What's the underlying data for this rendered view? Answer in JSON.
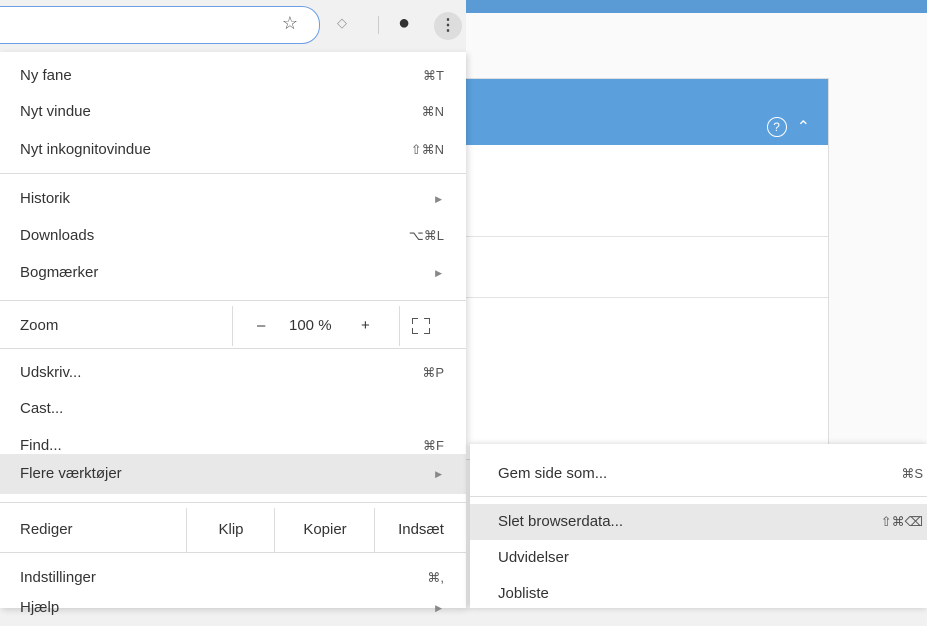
{
  "toolbar": {
    "star_icon": "☆",
    "extension_icon": "◇",
    "profile_icon": "●",
    "kebab_icon": "⋮"
  },
  "menu": {
    "new_tab": {
      "label": "Ny fane",
      "shortcut": "⌘T"
    },
    "new_window": {
      "label": "Nyt vindue",
      "shortcut": "⌘N"
    },
    "new_incognito": {
      "label": "Nyt inkognitovindue",
      "shortcut": "⇧⌘N"
    },
    "history": {
      "label": "Historik"
    },
    "downloads": {
      "label": "Downloads",
      "shortcut": "⌥⌘L"
    },
    "bookmarks": {
      "label": "Bogmærker"
    },
    "zoom": {
      "label": "Zoom",
      "minus": "–",
      "value": "100 %",
      "plus": "+"
    },
    "print": {
      "label": "Udskriv...",
      "shortcut": "⌘P"
    },
    "cast": {
      "label": "Cast..."
    },
    "find": {
      "label": "Find...",
      "shortcut": "⌘F"
    },
    "more_tools": {
      "label": "Flere værktøjer"
    },
    "edit": {
      "label": "Rediger",
      "cut": "Klip",
      "copy": "Kopier",
      "paste": "Indsæt"
    },
    "settings": {
      "label": "Indstillinger",
      "shortcut": "⌘,"
    },
    "help": {
      "label": "Hjælp"
    }
  },
  "submenu": {
    "save_page": {
      "label": "Gem side som...",
      "shortcut": "⌘S"
    },
    "clear_data": {
      "label": "Slet browserdata...",
      "shortcut": "⇧⌘⌫"
    },
    "extensions": {
      "label": "Udvidelser"
    },
    "task_manager": {
      "label": "Jobliste"
    }
  },
  "arrow_glyph": "▶",
  "panel": {
    "help_icon": "?",
    "collapse_icon": "⌃"
  }
}
